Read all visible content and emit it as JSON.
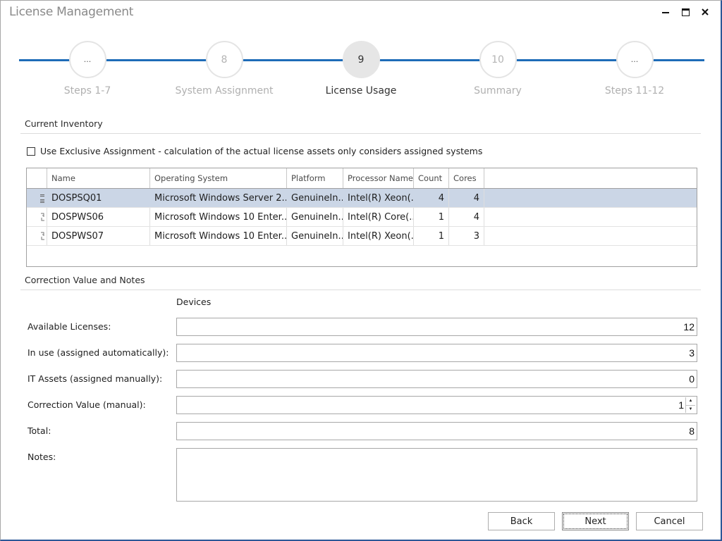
{
  "window": {
    "title": "License Management",
    "controls": [
      {
        "name": "minimize",
        "icon": "minimize-icon"
      },
      {
        "name": "maximize",
        "icon": "maximize-icon"
      },
      {
        "name": "close",
        "icon": "close-icon"
      }
    ]
  },
  "wizard": {
    "steps": [
      {
        "badge": "...",
        "label": "Steps 1-7",
        "active": false
      },
      {
        "badge": "8",
        "label": "System Assignment",
        "active": false
      },
      {
        "badge": "9",
        "label": "License Usage",
        "active": true
      },
      {
        "badge": "10",
        "label": "Summary",
        "active": false
      },
      {
        "badge": "...",
        "label": "Steps 11-12",
        "active": false
      }
    ],
    "accent_color": "#1e6cb8"
  },
  "inventory": {
    "section_title": "Current Inventory",
    "exclusive_assignment": {
      "label": "Use Exclusive Assignment - calculation of the actual license assets only considers assigned systems",
      "checked": false
    },
    "columns": [
      "Name",
      "Operating System",
      "Platform",
      "Processor Name",
      "Count",
      "Cores"
    ],
    "rows": [
      {
        "icon": "server-icon",
        "name": "DOSPSQ01",
        "os": "Microsoft Windows Server 2...",
        "platform": "GenuineIn...",
        "processor": "Intel(R) Xeon(...",
        "count": "4",
        "cores": "4",
        "selected": true
      },
      {
        "icon": "workstation-icon",
        "name": "DOSPWS06",
        "os": "Microsoft Windows 10 Enter...",
        "platform": "GenuineIn...",
        "processor": "Intel(R) Core(...",
        "count": "1",
        "cores": "4",
        "selected": false
      },
      {
        "icon": "workstation-icon",
        "name": "DOSPWS07",
        "os": "Microsoft Windows 10 Enter...",
        "platform": "GenuineIn...",
        "processor": "Intel(R) Xeon(...",
        "count": "1",
        "cores": "3",
        "selected": false
      }
    ],
    "selected_row_color": "#cbd6e6"
  },
  "correction": {
    "section_title": "Correction Value and Notes",
    "column_header": "Devices",
    "fields": {
      "available": {
        "label": "Available Licenses:",
        "value": "12"
      },
      "in_use": {
        "label": "In use (assigned automatically):",
        "value": "3"
      },
      "it_assets": {
        "label": "IT Assets (assigned manually):",
        "value": "0"
      },
      "correction": {
        "label": "Correction Value (manual):",
        "value": "1"
      },
      "total": {
        "label": "Total:",
        "value": "8"
      },
      "notes": {
        "label": "Notes:",
        "value": ""
      }
    }
  },
  "buttons": {
    "back": "Back",
    "next": "Next",
    "cancel": "Cancel"
  }
}
